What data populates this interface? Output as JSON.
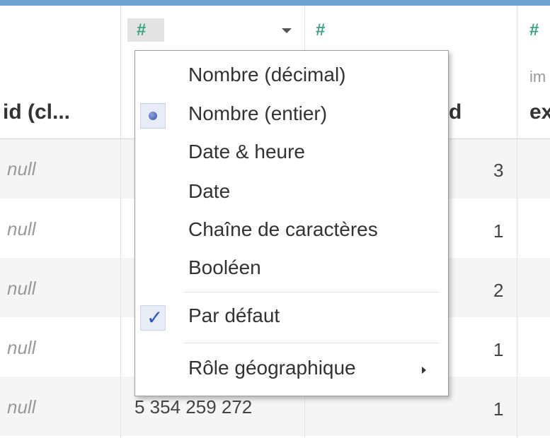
{
  "columns": {
    "col1_header": "id (cl...",
    "col2_type_icon": "#",
    "col3_header": "d",
    "col3_type_icon": "#",
    "col4_header": "ex",
    "col4_subheader": "im",
    "col4_type_icon": "#"
  },
  "rows": [
    {
      "col1": "null",
      "col3": "3"
    },
    {
      "col1": "null",
      "col3": "1"
    },
    {
      "col1": "null",
      "col3": "2"
    },
    {
      "col1": "null",
      "col3": "1"
    },
    {
      "col1": "null",
      "col2": "5 354 259 272",
      "col3": "1"
    }
  ],
  "menu": {
    "items": [
      {
        "label": "Nombre (décimal)",
        "state": "none"
      },
      {
        "label": "Nombre (entier)",
        "state": "radio-selected"
      },
      {
        "label": "Date & heure",
        "state": "none"
      },
      {
        "label": "Date",
        "state": "none"
      },
      {
        "label": "Chaîne de caractères",
        "state": "none"
      },
      {
        "label": "Booléen",
        "state": "none"
      },
      {
        "label": "Par défaut",
        "state": "checked"
      },
      {
        "label": "Rôle géographique",
        "state": "submenu"
      }
    ]
  },
  "colors": {
    "accent_bar": "#6fa3cf",
    "type_icon": "#3aa57c",
    "check": "#2d55c6"
  },
  "icons": [
    "number-type-icon",
    "dropdown-caret-icon",
    "radio-dot-icon",
    "checkmark-icon",
    "submenu-arrow-icon"
  ]
}
